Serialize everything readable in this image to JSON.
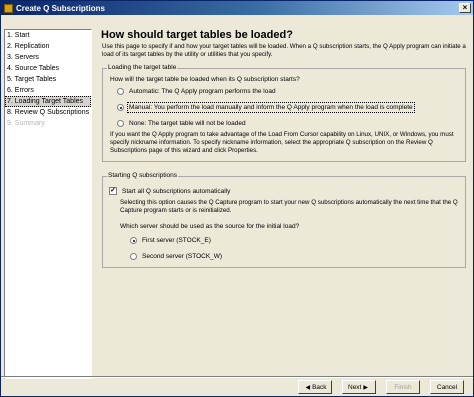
{
  "window": {
    "title": "Create Q Subscriptions",
    "close_glyph": "×"
  },
  "steps": [
    {
      "label": "1. Start",
      "state": "normal"
    },
    {
      "label": "2. Replication",
      "state": "normal"
    },
    {
      "label": "3. Servers",
      "state": "normal"
    },
    {
      "label": "4. Source Tables",
      "state": "normal"
    },
    {
      "label": "5. Target Tables",
      "state": "normal"
    },
    {
      "label": "6. Errors",
      "state": "normal"
    },
    {
      "label": "7. Loading Target Tables",
      "state": "current"
    },
    {
      "label": "8. Review Q Subscriptions",
      "state": "normal"
    },
    {
      "label": "9. Summary",
      "state": "disabled"
    }
  ],
  "page": {
    "heading": "How should target tables be loaded?",
    "intro": "Use this page to specify if and how your target tables will be loaded. When a Q subscription starts, the Q Apply program can initiate a load of its target tables by the utility or utilities that you specify."
  },
  "loading_group": {
    "title": "Loading the target table",
    "question": "How will the target table be loaded when its Q subscription starts?",
    "options": [
      {
        "label": "Automatic: The Q Apply program performs the load",
        "checked": false
      },
      {
        "label": "Manual: You perform the load manually and inform the Q Apply program when the load is complete",
        "checked": true
      },
      {
        "label": "None: The target table will not be loaded",
        "checked": false
      }
    ],
    "note": "If you want the Q Apply program to take advantage of the Load From Cursor capability on Linux, UNIX, or Windows, you must specify nickname information. To specify nickname information, select the appropriate Q subscription on the Review Q Subscriptions page of this wizard and click Properties."
  },
  "starting_group": {
    "title": "Starting Q subscriptions",
    "checkbox_label": "Start all Q subscriptions automatically",
    "checkbox_checked": true,
    "checkbox_mark": "✓",
    "description": "Selecting this option causes the Q Capture program to start your new Q subscriptions automatically the next time that the Q Capture program starts or is reinitialized.",
    "question": "Which server should be used as the source for the initial load?",
    "options": [
      {
        "label": "First server (STOCK_E)",
        "checked": true
      },
      {
        "label": "Second server (STOCK_W)",
        "checked": false
      }
    ]
  },
  "buttons": {
    "back": "Back",
    "next": "Next",
    "finish": "Finish",
    "cancel": "Cancel",
    "back_arrow": "◀",
    "next_arrow": "▶"
  }
}
